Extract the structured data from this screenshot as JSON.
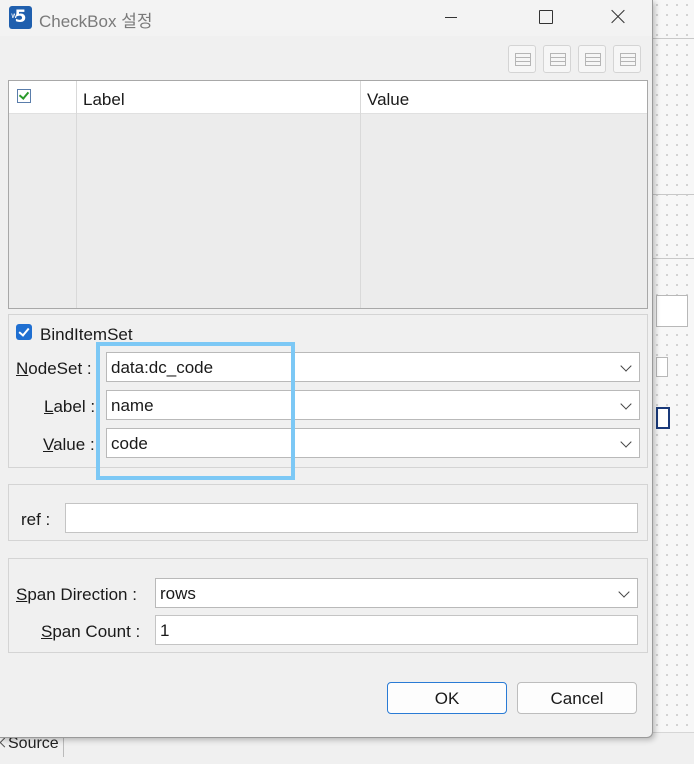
{
  "window": {
    "title": "CheckBox 설정",
    "app_icon_text": "5",
    "app_icon_sub": "w"
  },
  "toolbar": {
    "icons": [
      "add-row-icon",
      "insert-row-icon",
      "delete-row-icon",
      "clear-rows-icon"
    ]
  },
  "grid": {
    "columns": [
      "Label",
      "Value"
    ],
    "header_checked": true,
    "rows": []
  },
  "bind_item_set": {
    "label": "BindItemSet",
    "checked": true,
    "nodeset_label_u": "N",
    "nodeset_label_rest": "odeSet :",
    "nodeset_value": "data:dc_code",
    "label_label_u": "L",
    "label_label_rest": "abel :",
    "label_value": "name",
    "value_label_u": "V",
    "value_label_rest": "alue :",
    "value_value": "code"
  },
  "ref": {
    "label": "ref :",
    "value": ""
  },
  "span": {
    "direction_label_u": "S",
    "direction_label_rest": "pan Direction :",
    "direction_value": "rows",
    "count_label_u": "S",
    "count_label_rest": "pan Count :",
    "count_value": "1"
  },
  "buttons": {
    "ok": "OK",
    "cancel": "Cancel"
  },
  "background": {
    "source_tab": "Source"
  },
  "colors": {
    "accent": "#1f6fd1",
    "highlight": "#7cc8f5",
    "dialog_bg": "#f0f0f0"
  }
}
